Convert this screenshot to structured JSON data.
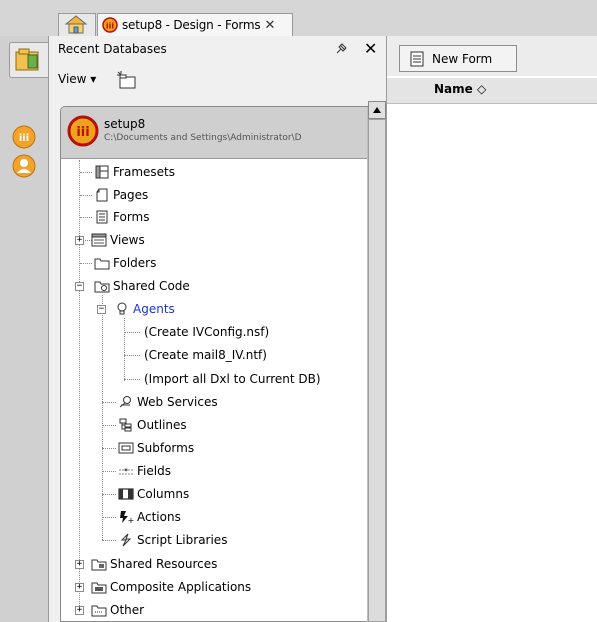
{
  "tabs": {
    "home_icon": "home-icon",
    "design_tab_label": "setup8 - Design - Forms"
  },
  "panel": {
    "title": "Recent Databases",
    "view_menu": "View ▾"
  },
  "database": {
    "name": "setup8",
    "path": "C:\\Documents and Settings\\Administrator\\D"
  },
  "tree": {
    "framesets": "Framesets",
    "pages": "Pages",
    "forms": "Forms",
    "views": "Views",
    "folders": "Folders",
    "shared_code": "Shared Code",
    "agents": "Agents",
    "agent_1": "(Create IVConfig.nsf)",
    "agent_2": "(Create mail8_IV.ntf)",
    "agent_3": "(Import all Dxl to Current DB)",
    "web_services": "Web Services",
    "outlines": "Outlines",
    "subforms": "Subforms",
    "fields": "Fields",
    "columns": "Columns",
    "actions": "Actions",
    "script_libraries": "Script Libraries",
    "shared_resources": "Shared Resources",
    "composite_applications": "Composite Applications",
    "other": "Other"
  },
  "right": {
    "new_form_label": "New Form",
    "column_name": "Name ◇"
  },
  "colors": {
    "selected_text": "#1a33d6",
    "logo": "#e8a12a"
  }
}
